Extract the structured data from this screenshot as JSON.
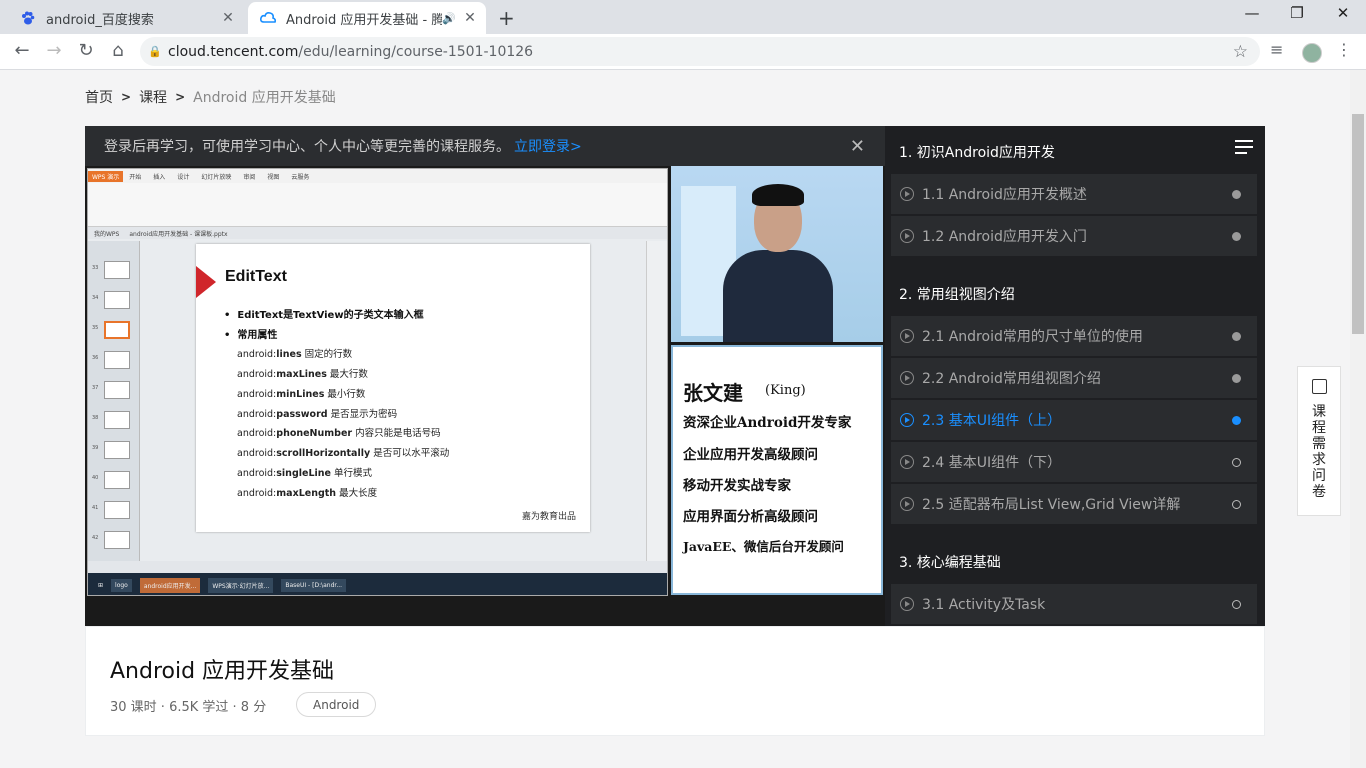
{
  "browser": {
    "tabs": [
      {
        "title": "android_百度搜索",
        "close": "✕"
      },
      {
        "title": "Android 应用开发基础 - 腾讯",
        "close": "✕"
      }
    ],
    "new_tab": "+",
    "url_host": "cloud.tencent.com",
    "url_path": "/edu/learning/course-1501-10126",
    "window_controls": [
      "—",
      "❐",
      "✕"
    ]
  },
  "breadcrumb": {
    "home": "首页",
    "courses": "课程",
    "current": "Android 应用开发基础"
  },
  "player": {
    "login_notice": "登录后再学习，可使用学习中心、个人中心等更完善的课程服务。",
    "login_link": "立即登录>",
    "close": "✕"
  },
  "slide": {
    "title": "EditText",
    "bullet1": "EditText是TextView的子类文本输入框",
    "bullet2": "常用属性",
    "attrs": [
      {
        "prefix": "android:",
        "name": "lines",
        "desc": " 固定的行数"
      },
      {
        "prefix": "android:",
        "name": "maxLines",
        "desc": " 最大行数"
      },
      {
        "prefix": "android:",
        "name": "minLines",
        "desc": " 最小行数"
      },
      {
        "prefix": "android:",
        "name": "password",
        "desc": " 是否显示为密码"
      },
      {
        "prefix": "android:",
        "name": "phoneNumber",
        "desc": " 内容只能是电话号码"
      },
      {
        "prefix": "android:",
        "name": "scrollHorizontally",
        "desc": " 是否可以水平滚动"
      },
      {
        "prefix": "android:",
        "name": "singleLine",
        "desc": " 单行模式"
      },
      {
        "prefix": "android:",
        "name": "maxLength",
        "desc": " 最大长度"
      }
    ],
    "footer": "嘉为教育出品"
  },
  "wps": {
    "app": "WPS 演示",
    "menu": [
      "开始",
      "插入",
      "设计",
      "幻灯片放映",
      "审阅",
      "视图",
      "云服务"
    ],
    "tabs": [
      "我的WPS",
      "android应用开发基础 - 课课板.pptx"
    ],
    "taskbar": [
      "logo",
      "android应用开发...",
      "WPS演示·幻灯片放...",
      "BaseUI - [D:\\andr..."
    ],
    "thumb_numbers": [
      "33",
      "34",
      "35",
      "36",
      "37",
      "38",
      "39",
      "40",
      "41",
      "42"
    ]
  },
  "bio": {
    "name": "张文建",
    "alias": "(King)",
    "lines": [
      "资深企业Android开发专家",
      "企业应用开发高级顾问",
      "移动开发实战专家",
      "应用界面分析高级顾问",
      "JavaEE、微信后台开发顾问"
    ]
  },
  "sidebar": {
    "chapters": [
      "1. 初识Android应用开发",
      "2. 常用组视图介绍",
      "3. 核心编程基础"
    ],
    "lessons": [
      {
        "label": "1.1 Android应用开发概述",
        "state": "done"
      },
      {
        "label": "1.2 Android应用开发入门",
        "state": "done"
      },
      {
        "label": "2.1 Android常用的尺寸单位的使用",
        "state": "done"
      },
      {
        "label": "2.2 Android常用组视图介绍",
        "state": "done"
      },
      {
        "label": "2.3 基本UI组件（上）",
        "state": "current"
      },
      {
        "label": "2.4 基本UI组件（下）",
        "state": "todo"
      },
      {
        "label": "2.5 适配器布局List View,Grid View详解",
        "state": "todo"
      },
      {
        "label": "3.1 Activity及Task",
        "state": "todo"
      }
    ]
  },
  "course": {
    "title": "Android 应用开发基础",
    "meta": "30 课时 · 6.5K 学过 · 8 分",
    "tag": "Android"
  },
  "survey": {
    "label": "课程需求问卷"
  },
  "colors": {
    "accent": "#1a8fff",
    "sidebar_bg": "#1e1f22",
    "slide_red": "#d0262b"
  }
}
